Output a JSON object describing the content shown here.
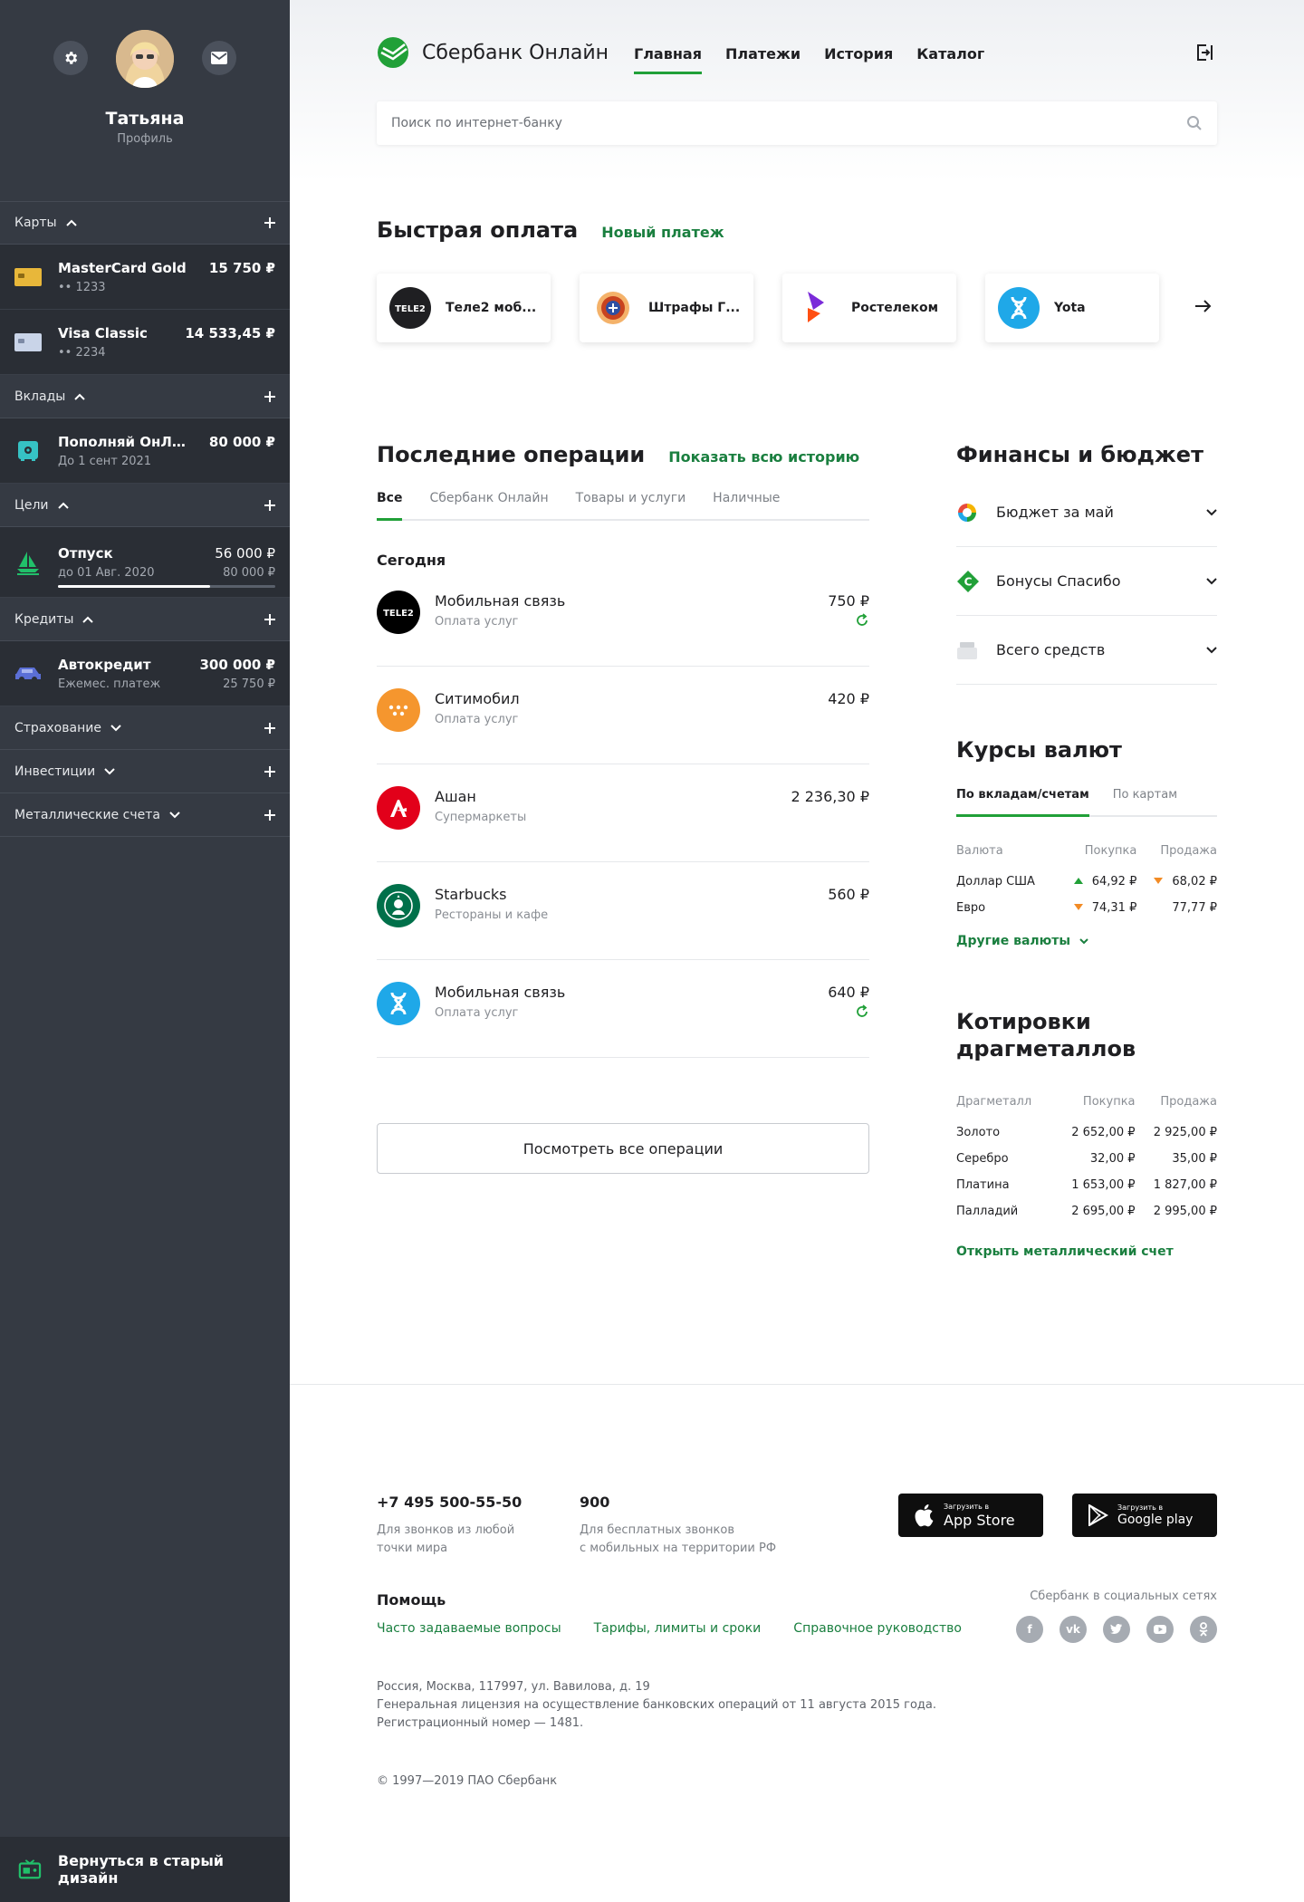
{
  "profile": {
    "name": "Татьяна",
    "subtitle": "Профиль"
  },
  "sidebar": {
    "sections": {
      "cards": "Карты",
      "deposits": "Вклады",
      "goals": "Цели",
      "credits": "Кредиты",
      "insurance": "Страхование",
      "investments": "Инвестиции",
      "metals": "Металлические счета"
    },
    "cards": [
      {
        "name": "MasterCard Gold",
        "number": "•• 1233",
        "balance": "15 750 ₽"
      },
      {
        "name": "Visa Classic",
        "number": "•• 2234",
        "balance": "14 533,45 ₽"
      }
    ],
    "deposit": {
      "name": "Пополняй ОнЛ@йн",
      "term": "До 1 сент 2021",
      "amount": "80 000 ₽"
    },
    "goal": {
      "name": "Отпуск",
      "date": "до 01 Авг. 2020",
      "current": "56 000 ₽",
      "target": "80 000 ₽",
      "progress": 0.7
    },
    "credit": {
      "name": "Автокредит",
      "desc": "Ежемес. платеж",
      "amount": "300 000 ₽",
      "payment": "25 750 ₽"
    },
    "back_label": "Вернуться в старый дизайн"
  },
  "header": {
    "brand": "Сбербанк Онлайн",
    "nav": [
      "Главная",
      "Платежи",
      "История",
      "Каталог"
    ],
    "active_nav": "Главная",
    "search_placeholder": "Поиск по интернет-банку"
  },
  "quick_pay": {
    "title": "Быстрая оплата",
    "new_payment": "Новый платеж",
    "items": [
      "Теле2 моб...",
      "Штрафы Г...",
      "Ростелеком",
      "Yota"
    ]
  },
  "operations": {
    "title": "Последние операции",
    "show_all": "Показать всю историю",
    "tabs": [
      "Все",
      "Сбербанк Онлайн",
      "Товары и услуги",
      "Наличные"
    ],
    "day": "Сегодня",
    "items": [
      {
        "name": "Мобильная связь",
        "category": "Оплата услуг",
        "amount": "750 ₽"
      },
      {
        "name": "Ситимобил",
        "category": "Оплата услуг",
        "amount": "420 ₽"
      },
      {
        "name": "Ашан",
        "category": "Супермаркеты",
        "amount": "2 236,30 ₽"
      },
      {
        "name": "Starbucks",
        "category": "Рестораны и кафе",
        "amount": "560 ₽"
      },
      {
        "name": "Мобильная связь",
        "category": "Оплата услуг",
        "amount": "640 ₽"
      }
    ],
    "all_button": "Посмотреть все операции"
  },
  "finance": {
    "title": "Финансы и бюджет",
    "rows": [
      "Бюджет за май",
      "Бонусы Спасибо",
      "Всего средств"
    ]
  },
  "rates": {
    "title": "Курсы валют",
    "tabs": [
      "По вкладам/счетам",
      "По картам"
    ],
    "headers": [
      "Валюта",
      "Покупка",
      "Продажа"
    ],
    "rows": [
      {
        "currency": "Доллар США",
        "buy": "64,92 ₽",
        "sell": "68,02 ₽"
      },
      {
        "currency": "Евро",
        "buy": "74,31 ₽",
        "sell": "77,77 ₽"
      }
    ],
    "more": "Другие валюты"
  },
  "metals": {
    "title": "Котировки драгметаллов",
    "headers": [
      "Драгметалл",
      "Покупка",
      "Продажа"
    ],
    "rows": [
      {
        "metal": "Золото",
        "buy": "2 652,00 ₽",
        "sell": "2 925,00 ₽"
      },
      {
        "metal": "Серебро",
        "buy": "32,00 ₽",
        "sell": "35,00 ₽"
      },
      {
        "metal": "Платина",
        "buy": "1 653,00 ₽",
        "sell": "1 827,00 ₽"
      },
      {
        "metal": "Палладий",
        "buy": "2 695,00 ₽",
        "sell": "2 995,00 ₽"
      }
    ],
    "open_link": "Открыть металлический счет"
  },
  "footer": {
    "phone1": "+7 495 500-55-50",
    "phone1_desc_1": "Для звонков из любой",
    "phone1_desc_2": "точки мира",
    "phone2": "900",
    "phone2_desc_1": "Для бесплатных звонков",
    "phone2_desc_2": "с мобильных на территории РФ",
    "appstore_small": "Загрузить в",
    "appstore_big": "App Store",
    "gplay_small": "Загрузить в",
    "gplay_big": "Google play",
    "help_title": "Помощь",
    "help_links": [
      "Часто задаваемые вопросы",
      "Тарифы, лимиты и сроки",
      "Справочное руководство"
    ],
    "social_title": "Сбербанк в социальных сетях",
    "address_1": "Россия, Москва, 117997, ул. Вавилова, д. 19",
    "address_2": "Генеральная лицензия на осуществление банковских операций от 11 августа 2015 года.",
    "address_3": "Регистрационный номер — 1481.",
    "copyright": "© 1997—2019 ПАО Сбербанк"
  },
  "colors": {
    "accent": "#21a038",
    "link": "#1a7f3f",
    "sidebar": "#353a43",
    "sidebar_dark": "#2a2e35"
  }
}
